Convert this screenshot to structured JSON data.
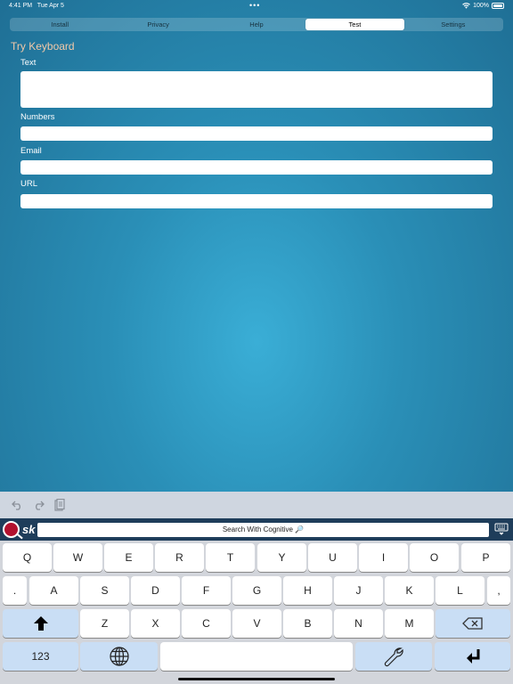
{
  "status": {
    "time": "4:41 PM",
    "date": "Tue Apr 5",
    "battery": "100%"
  },
  "tabs": [
    {
      "label": "Install",
      "active": false
    },
    {
      "label": "Privacy",
      "active": false
    },
    {
      "label": "Help",
      "active": false
    },
    {
      "label": "Test",
      "active": true
    },
    {
      "label": "Settings",
      "active": false
    }
  ],
  "page": {
    "title": "Try Keyboard",
    "fields": {
      "text_label": "Text",
      "numbers_label": "Numbers",
      "email_label": "Email",
      "url_label": "URL"
    }
  },
  "toolbar": {
    "icons": [
      "undo-icon",
      "redo-icon",
      "paste-icon"
    ]
  },
  "keyboard": {
    "brand": "sk",
    "search_label": "Search With Cognitive 🔎",
    "rows": [
      [
        "Q",
        "W",
        "E",
        "R",
        "T",
        "Y",
        "U",
        "I",
        "O",
        "P"
      ],
      [
        ".",
        "A",
        "S",
        "D",
        "F",
        "G",
        "H",
        "J",
        "K",
        "L",
        ","
      ],
      [
        "Z",
        "X",
        "C",
        "V",
        "B",
        "N",
        "M"
      ]
    ],
    "numbers_key": "123",
    "colors": {
      "header": "#1e3d5a",
      "accent_key": "#c9def5",
      "logo": "#b2112e"
    }
  }
}
